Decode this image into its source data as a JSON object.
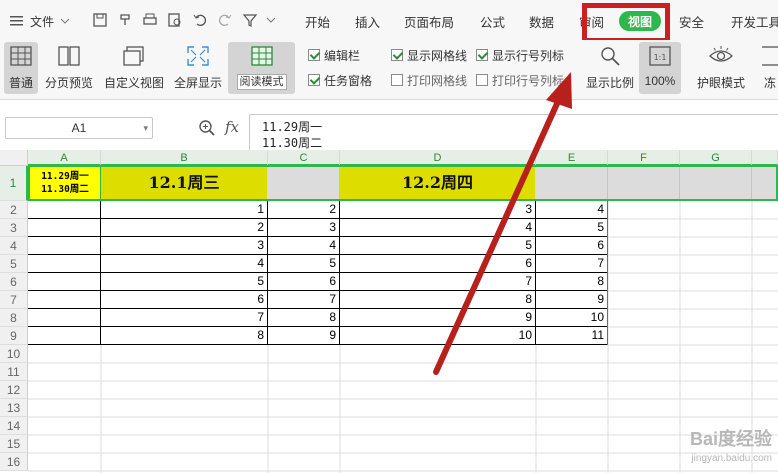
{
  "file_menu": {
    "label": "文件"
  },
  "tabs": {
    "start": "开始",
    "insert": "插入",
    "layout": "页面布局",
    "formula": "公式",
    "data": "数据",
    "review": "审阅",
    "view": "视图",
    "security": "安全",
    "devtools": "开发工具"
  },
  "ribbon": {
    "normal": "普通",
    "page_break_preview": "分页预览",
    "custom_view": "自定义视图",
    "full_screen": "全屏显示",
    "reading_mode": "阅读模式",
    "edit_bar": "编辑栏",
    "task_pane": "任务窗格",
    "show_gridlines": "显示网格线",
    "print_gridlines": "打印网格线",
    "show_headers": "显示行号列标",
    "print_headers": "打印行号列标",
    "zoom": "显示比例",
    "zoom_100": "100%",
    "eye_protection": "护眼模式",
    "freeze": "冻"
  },
  "formula_bar": {
    "name_box": "A1",
    "fx": "fx",
    "content_line1": "11.29周一",
    "content_line2": "11.30周二"
  },
  "columns": [
    "A",
    "B",
    "C",
    "D",
    "E",
    "F",
    "G"
  ],
  "rows": [
    "1",
    "2",
    "3",
    "4",
    "5",
    "6",
    "7",
    "8",
    "9",
    "10",
    "11",
    "12",
    "13",
    "14",
    "15",
    "16"
  ],
  "header_row": {
    "a1_line1": "11.29周一",
    "a1_line2": "11.30周二",
    "b1": "12.1周三",
    "d1": "12.2周四"
  },
  "table": {
    "B": [
      "1",
      "2",
      "3",
      "4",
      "5",
      "6",
      "7",
      "8"
    ],
    "C": [
      "2",
      "3",
      "4",
      "5",
      "6",
      "7",
      "8",
      "9"
    ],
    "D": [
      "3",
      "4",
      "5",
      "6",
      "7",
      "8",
      "9",
      "10"
    ],
    "E": [
      "4",
      "5",
      "6",
      "7",
      "8",
      "9",
      "10",
      "11"
    ]
  },
  "watermark": {
    "main": "Bai度经验",
    "sub": "jingyan.baidu.com"
  },
  "colors": {
    "accent": "#2db84d",
    "highlight_box": "#cc1f1f",
    "arrow": "#b8201c",
    "yellow": "#dddd00"
  }
}
